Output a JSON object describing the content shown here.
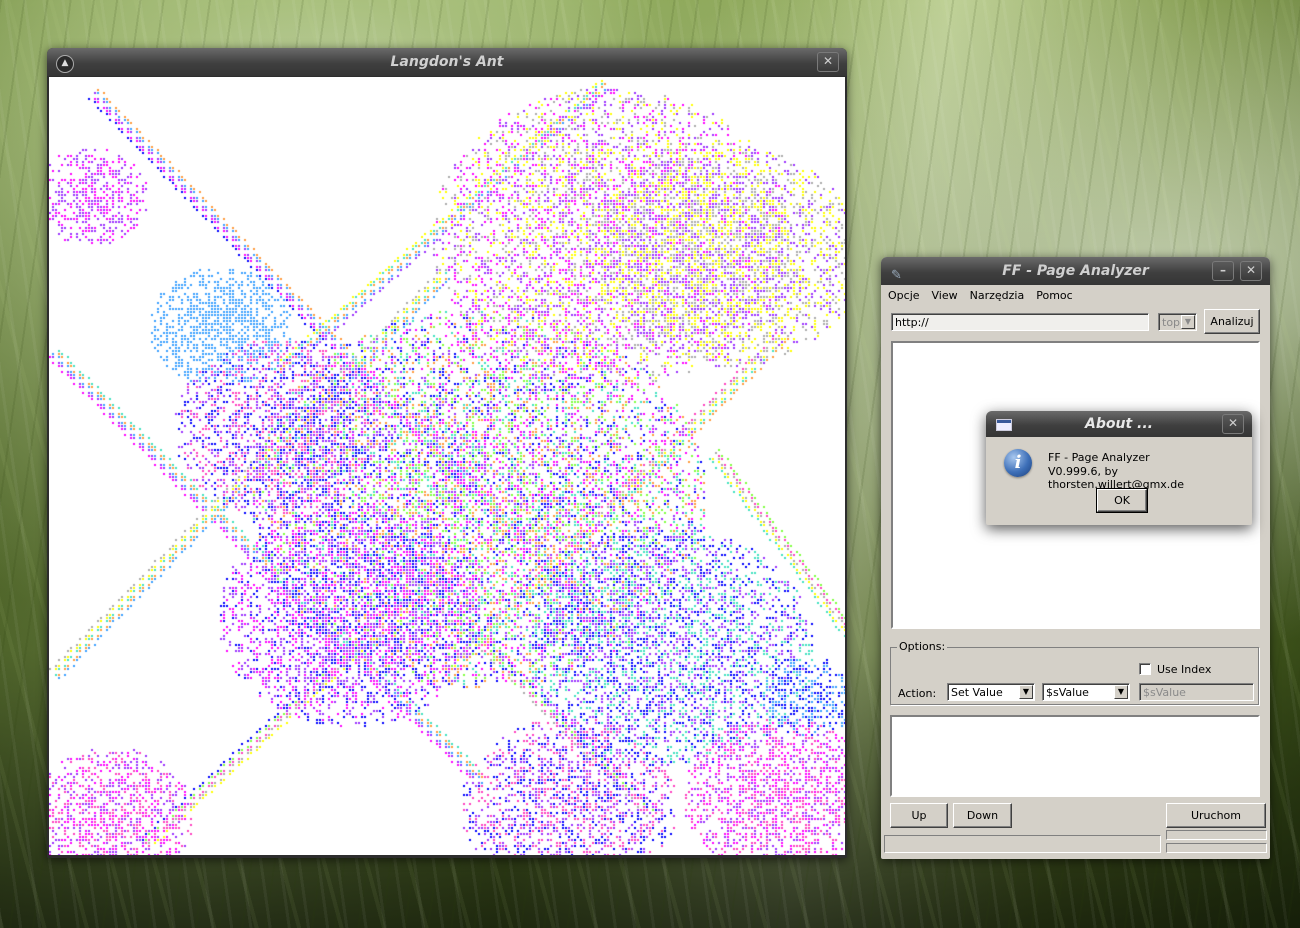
{
  "desktop": {
    "wallpaper": "green grass",
    "colors": {
      "title_bar": "#3f3f3f",
      "dialog_face": "#d4d0c8"
    }
  },
  "ant_window": {
    "title": "Langdon's Ant",
    "icons": {
      "app": "app-logo-icon",
      "close": "close-icon"
    },
    "palette": [
      "#0000ff",
      "#ff00ff",
      "#9b30ff",
      "#3aa0ff",
      "#ff9a3c",
      "#40e0c0",
      "#ffff00",
      "#aaaaaa",
      "#ff3fbf",
      "#80ff40"
    ]
  },
  "analyzer": {
    "title": "FF - Page Analyzer",
    "menu": [
      "Opcje",
      "View",
      "Narzędzia",
      "Pomoc"
    ],
    "url_value": "http://",
    "frame_select": "top",
    "analyze_button": "Analizuj",
    "options_label": "Options:",
    "use_index_label": "Use Index",
    "action_label": "Action:",
    "action_select": "Set Value",
    "value_select": "$sValue",
    "value_input": "$sValue",
    "up_button": "Up",
    "down_button": "Down",
    "run_button": "Uruchom"
  },
  "about": {
    "title": "About ...",
    "line1": "FF - Page Analyzer",
    "line2": "V0.999.6, by thorsten.willert@gmx.de",
    "ok_button": "OK"
  }
}
